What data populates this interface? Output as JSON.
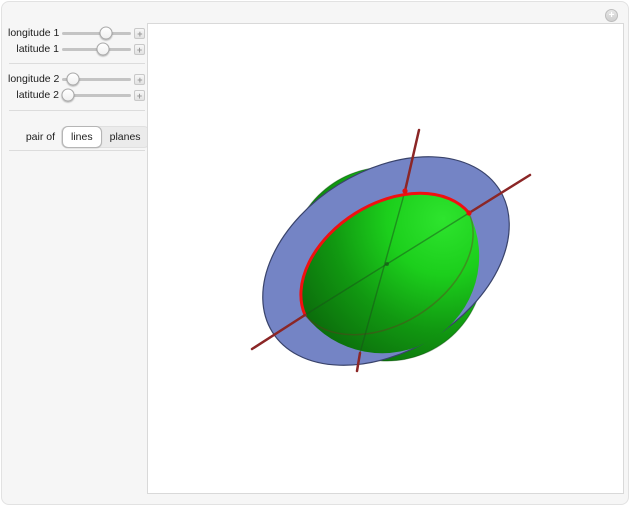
{
  "controls": {
    "stepper_glyph": "+",
    "expand_glyph": "+",
    "sliders": [
      {
        "label": "longitude 1",
        "position": 0.63
      },
      {
        "label": "latitude 1",
        "position": 0.59
      },
      {
        "label": "longitude 2",
        "position": 0.15
      },
      {
        "label": "latitude 2",
        "position": 0.09
      }
    ],
    "pair_of": {
      "label": "pair of",
      "options": [
        "lines",
        "planes"
      ],
      "selected": "lines"
    }
  },
  "scene": {
    "description": "green sphere intersected by a blue plane disk; red great circle at the intersection; two dark-red lines through the sphere center pierce the sphere at two marked points",
    "colors": {
      "sphere_highlight": "#2ee42e",
      "sphere_mid": "#1ccf1c",
      "sphere_shade": "#119811",
      "sphere_dark": "#0a5f0a",
      "plane_fill": "#7484c5",
      "plane_edge": "#39436b",
      "great_circle": "#f01010",
      "line": "#8b2626",
      "marker": "#e01010"
    }
  }
}
